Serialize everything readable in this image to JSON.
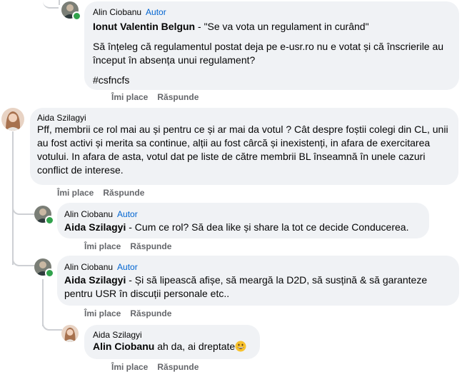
{
  "comments": [
    {
      "author": "Alin Ciobanu",
      "badge": "Autor",
      "mention": "Ionut Valentin Belgun",
      "quote": " - \"Se va vota un regulament in curând\"",
      "paragraph": "Să înțeleg că regulamentul postat deja pe e-usr.ro nu e votat și că înscrierile au început în absența unui regulament?",
      "hashtag": "#csfncfs",
      "like": "Îmi place",
      "reply": "Răspunde"
    },
    {
      "author": "Aida Szilagyi",
      "text": "Pff, membrii ce rol mai au și pentru ce și ar mai da votul ? Cât despre foștii colegi din CL, unii au fost activi și merita sa continue, alții au fost cârcă și inexistenți, in afara de exercitarea votului. In afara de asta, votul dat pe liste de către membrii BL înseamnă în unele cazuri conflict de interese.",
      "like": "Îmi place",
      "reply": "Răspunde"
    },
    {
      "author": "Alin Ciobanu",
      "badge": "Autor",
      "mention": "Aida Szilagyi",
      "text": " - Cum ce rol? Să dea like și share la tot ce decide Conducerea.",
      "like": "Îmi place",
      "reply": "Răspunde"
    },
    {
      "author": "Alin Ciobanu",
      "badge": "Autor",
      "mention": "Aida Szilagyi",
      "text": " - Și să lipească afișe, să meargă la D2D, să susțină & să garanteze pentru USR în discuții personale etc..",
      "like": "Îmi place",
      "reply": "Răspunde"
    },
    {
      "author": "Aida Szilagyi",
      "mention": "Alin Ciobanu",
      "text": " ah da, ai dreptate",
      "emoji": "grinning-face-emoji",
      "like": "Îmi place",
      "reply": "Răspunde"
    }
  ],
  "colors": {
    "bubble": "#f0f2f5",
    "author_badge": "#0064d1",
    "action_text": "#65676b",
    "online": "#31a24c",
    "thread_line": "#ced0d4"
  }
}
